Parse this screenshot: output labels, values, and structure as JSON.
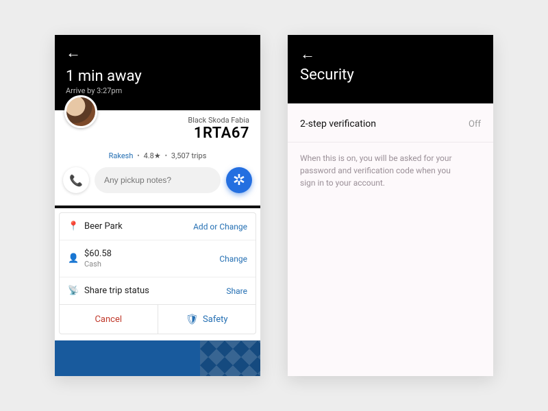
{
  "ride": {
    "status_title": "1 min away",
    "arrive_by": "Arrive by 3:27pm",
    "car_desc": "Black Skoda Fabia",
    "plate": "1RTA67",
    "driver_name": "Rakesh",
    "rating": "4.8★",
    "trips": "3,507 trips",
    "notes_placeholder": "Any pickup notes?",
    "dest": "Beer Park",
    "dest_action": "Add or Change",
    "fare": "$60.58",
    "payment": "Cash",
    "payment_action": "Change",
    "share_label": "Share trip status",
    "share_action": "Share",
    "cancel": "Cancel",
    "safety": "Safety"
  },
  "security": {
    "title": "Security",
    "item_label": "2-step verification",
    "item_state": "Off",
    "desc": "When this is on, you will be asked for your password and verification code when you sign in to your account."
  }
}
